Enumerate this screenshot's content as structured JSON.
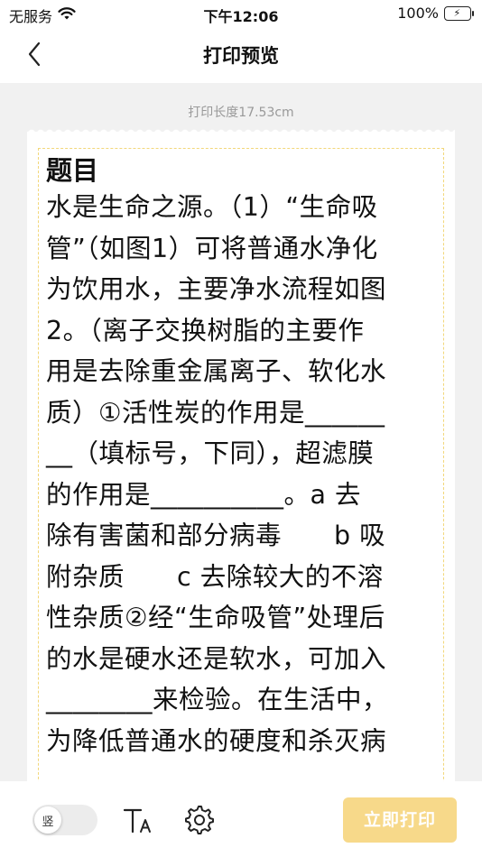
{
  "status_bar": {
    "carrier": "无服务",
    "time": "下午12:06",
    "battery": "100%"
  },
  "nav": {
    "title": "打印预览"
  },
  "preview": {
    "print_length": "打印长度17.53cm",
    "heading": "题目",
    "lines": [
      "水是生命之源。（1）“生命吸",
      "管”（如图1）可将普通水净化",
      "为饮用水，主要净水流程如图",
      "2。（离子交换树脂的主要作",
      "用是去除重金属离子、软化水",
      "质）①活性炭的作用是______",
      "__（填标号，下同），超滤膜",
      "的作用是__________。a 去",
      "除有害菌和部分病毒　　b 吸",
      "附杂质　　c 去除较大的不溶",
      "性杂质②经“生命吸管”处理后",
      "的水是硬水还是软水，可加入",
      "________来检验。在生活中，",
      "为降低普通水的硬度和杀灭病"
    ]
  },
  "toolbar": {
    "orientation_label": "竖",
    "print_button_label": "立即打印"
  },
  "colors": {
    "print_button": "#f7d98a",
    "dashed_border": "#f2d77a",
    "battery_fill": "#34c759"
  }
}
